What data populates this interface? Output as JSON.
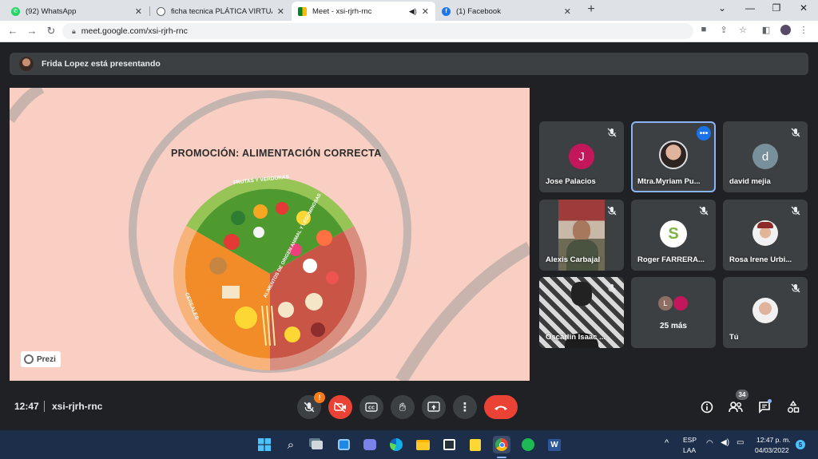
{
  "browser": {
    "tabs": [
      {
        "title": "(92) WhatsApp",
        "favicon": "whatsapp-icon",
        "color": "#25d366",
        "active": false
      },
      {
        "title": "ficha tecnica PLÁTICA VIRTUAL d",
        "favicon": "globe-icon",
        "color": "#5f6368",
        "active": false
      },
      {
        "title": "Meet - xsi-rjrh-rnc",
        "favicon": "meet-icon",
        "color": "#00897b",
        "active": true
      },
      {
        "title": "(1) Facebook",
        "favicon": "facebook-icon",
        "color": "#1877f2",
        "active": false
      }
    ],
    "url": "meet.google.com/xsi-rjrh-rnc"
  },
  "meet": {
    "presenter_text": "Frida Lopez está presentando",
    "slide": {
      "title": "PROMOCIÓN: ALIMENTACIÓN CORRECTA",
      "section_fruits": "FRUTAS Y VERDURAS",
      "section_cereals": "CEREALES",
      "section_animal": "ALIMENTOS DE ORIGEN ANIMAL Y LEGUMINOSAS",
      "prezi_label": "Prezi"
    },
    "participants": [
      {
        "name": "Jose Palacios",
        "initial": "J",
        "avatar_color": "#c2185b",
        "muted": true
      },
      {
        "name": "Mtra.Myriam Pu...",
        "initial": "",
        "avatar_color": "#d9b8a4",
        "muted": false,
        "selected": true
      },
      {
        "name": "david mejia",
        "initial": "d",
        "avatar_color": "#78909c",
        "muted": true
      },
      {
        "name": "Alexis Carbajal",
        "muted": true
      },
      {
        "name": "Roger FARRERA...",
        "muted": true
      },
      {
        "name": "Rosa Irene Urbi...",
        "muted": true
      },
      {
        "name": "Oscarlin Isaac ...",
        "muted": true
      },
      {
        "name": "25 más",
        "initial": "L"
      },
      {
        "name": "Tú",
        "muted": true
      }
    ],
    "time": "12:47",
    "meeting_code": "xsi-rjrh-rnc",
    "participant_count": "34",
    "warning_badge": "!"
  },
  "taskbar": {
    "lang_top": "ESP",
    "lang_bottom": "LAA",
    "clock_time": "12:47 p. m.",
    "clock_date": "04/03/2022",
    "notification_count": "5"
  }
}
